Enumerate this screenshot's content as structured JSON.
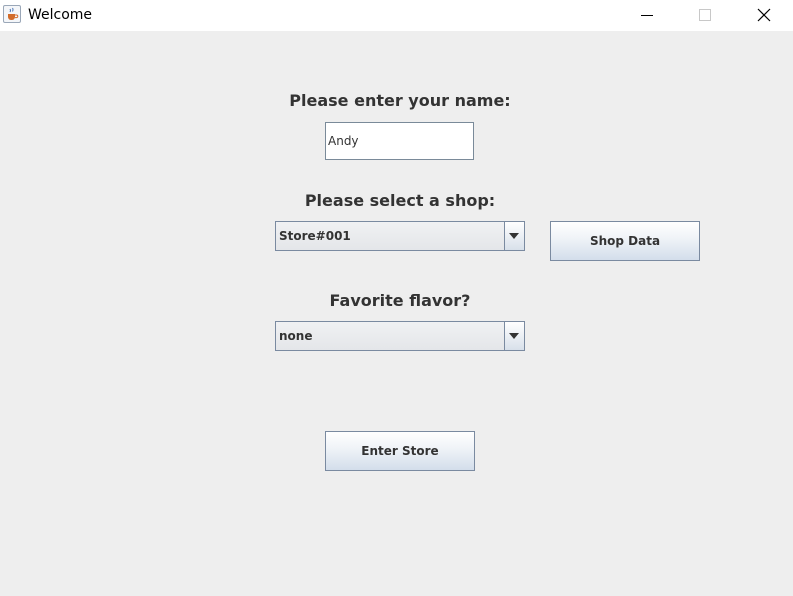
{
  "window": {
    "title": "Welcome",
    "icon": "java-cup-icon"
  },
  "form": {
    "name_label": "Please enter your name:",
    "name_value": "Andy",
    "shop_label": "Please select a shop:",
    "shop_selected": "Store#001",
    "shop_data_button": "Shop Data",
    "flavor_label": "Favorite flavor?",
    "flavor_selected": "none",
    "enter_button": "Enter Store"
  }
}
